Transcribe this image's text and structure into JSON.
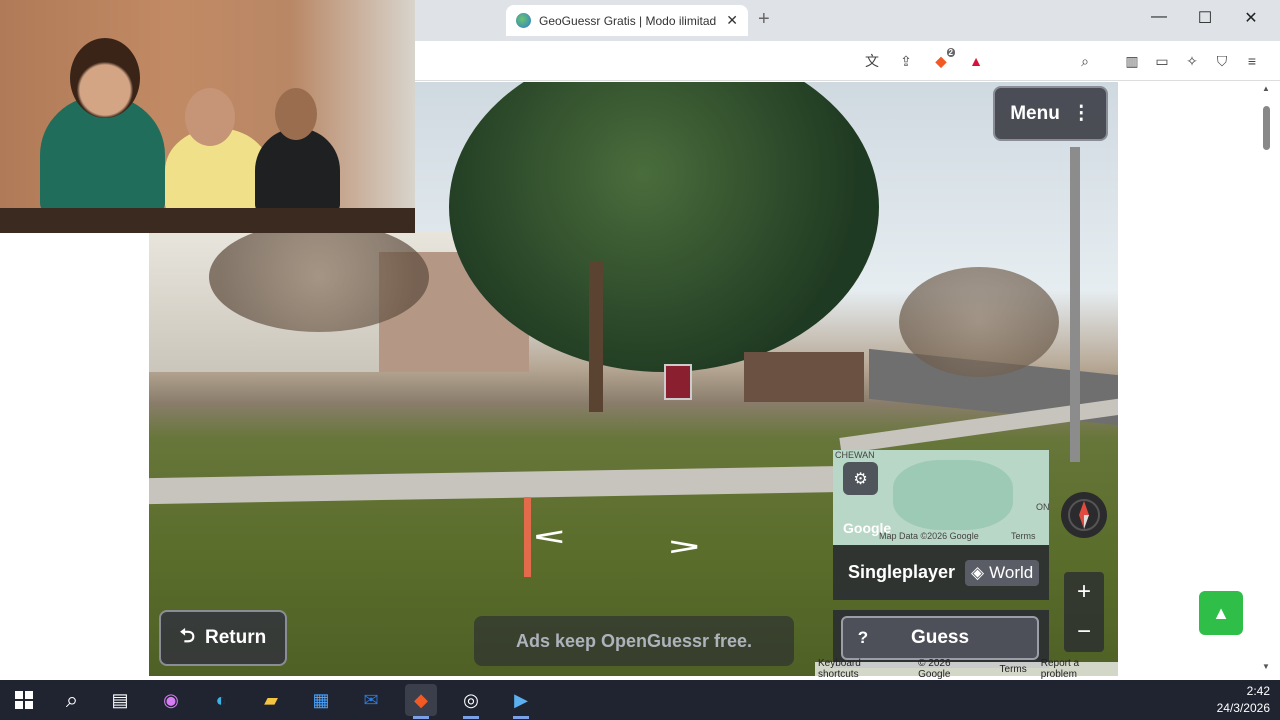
{
  "browser": {
    "tab_title": "GeoGuessr Gratis | Modo ilimitad",
    "tab_close": "✕",
    "new_tab": "+",
    "window_controls": {
      "minimize": "—",
      "maximize": "☐",
      "close": "✕"
    },
    "shield_badge": "2"
  },
  "game": {
    "menu_label": "Menu",
    "menu_dots": "⋮",
    "return_label": "Return",
    "return_icon": "⮌",
    "ads_text": "Ads keep OpenGuessr free.",
    "mode_label": "Singleplayer",
    "world_label": "World",
    "guess_label": "Guess",
    "guess_icon": "?",
    "zoom_in": "+",
    "zoom_out": "−",
    "map": {
      "region_label": "CHEWAN",
      "region_label2": "ON",
      "google_logo": "Google",
      "map_data": "Map Data ©2026 Google",
      "terms": "Terms"
    },
    "footer": {
      "keyboard_shortcuts": "Keyboard shortcuts",
      "copyright": "© 2026 Google",
      "terms": "Terms",
      "report": "Report a problem"
    },
    "scroll_top_icon": "▲"
  },
  "taskbar": {
    "time": "2:42",
    "date": "24/3/2026",
    "icons": [
      "windows-start-icon",
      "search-icon",
      "task-view-icon",
      "copilot-icon",
      "edge-icon",
      "file-explorer-icon",
      "store-icon",
      "outlook-icon",
      "brave-icon",
      "obs-icon",
      "video-player-icon"
    ]
  },
  "colors": {
    "accent_green": "#2fbf49",
    "brave_orange": "#f15a24",
    "panel_dark": "#32343c"
  }
}
